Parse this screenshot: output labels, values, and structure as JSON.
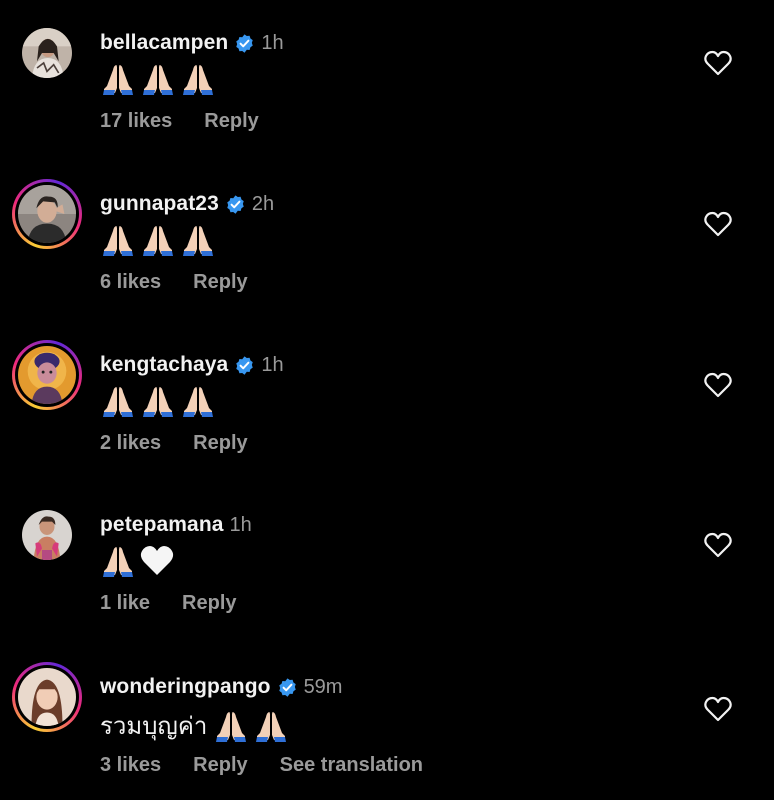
{
  "comments": [
    {
      "username": "bellacampen",
      "verified": true,
      "time": "1h",
      "text": "",
      "emojis": [
        "pray",
        "pray",
        "pray"
      ],
      "likes": "17 likes",
      "reply": "Reply",
      "story_ring": false
    },
    {
      "username": "gunnapat23",
      "verified": true,
      "time": "2h",
      "text": "",
      "emojis": [
        "pray",
        "pray",
        "pray"
      ],
      "likes": "6 likes",
      "reply": "Reply",
      "story_ring": true
    },
    {
      "username": "kengtachaya",
      "verified": true,
      "time": "1h",
      "text": "",
      "emojis": [
        "pray",
        "pray",
        "pray"
      ],
      "likes": "2 likes",
      "reply": "Reply",
      "story_ring": true
    },
    {
      "username": "petepamana",
      "verified": false,
      "time": "1h",
      "text": "",
      "emojis": [
        "pray",
        "white-heart"
      ],
      "likes": "1 like",
      "reply": "Reply",
      "story_ring": false
    },
    {
      "username": "wonderingpango",
      "verified": true,
      "time": "59m",
      "text": "รวมบุญค่า",
      "emojis": [
        "pray",
        "pray"
      ],
      "likes": "3 likes",
      "reply": "Reply",
      "see_translation": "See translation",
      "story_ring": true
    }
  ],
  "colors": {
    "background": "#000000",
    "username": "#f2f2f2",
    "meta": "#9a9a9a",
    "verified_badge": "#3897f0"
  }
}
